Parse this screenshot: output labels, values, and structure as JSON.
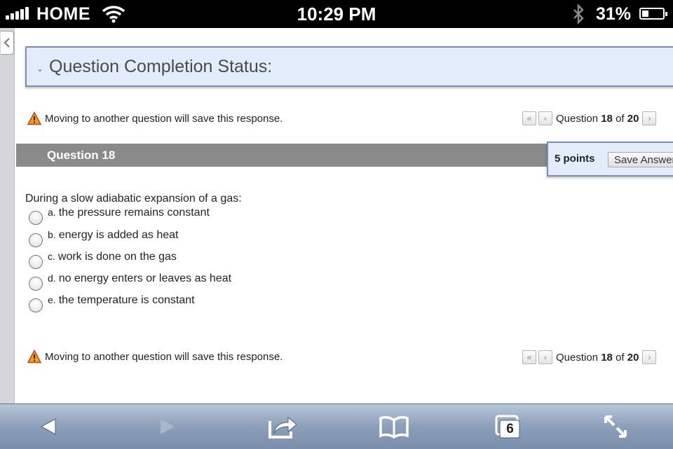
{
  "status_bar": {
    "carrier": "HOME",
    "time": "10:29 PM",
    "battery_percent": "31%",
    "battery_level": 0.31
  },
  "quiz": {
    "completion_status_title": "Question Completion Status:",
    "save_warning": "Moving to another question will save this response.",
    "nav": {
      "prefix": "Question",
      "current": "18",
      "of_label": "of",
      "total": "20"
    },
    "question_title": "Question 18",
    "points": "5 points",
    "save_button": "Save Answer",
    "question_text": "During a slow adiabatic expansion of a gas:",
    "options": [
      {
        "letter": "a.",
        "text": "the pressure remains constant"
      },
      {
        "letter": "b.",
        "text": "energy is added as heat"
      },
      {
        "letter": "c.",
        "text": "work is done on the gas"
      },
      {
        "letter": "d.",
        "text": "no energy enters or leaves as heat"
      },
      {
        "letter": "e.",
        "text": "the temperature is constant"
      }
    ]
  },
  "toolbar": {
    "tabs_count": "6",
    "icons": [
      "back-arrow-icon",
      "forward-arrow-icon",
      "share-icon",
      "bookmarks-icon",
      "tabs-icon",
      "fullscreen-icon"
    ]
  },
  "colors": {
    "panel_bg": "#e2ecfb",
    "panel_border": "#7b8fb4",
    "header_gray": "#8a8a8a",
    "warning_orange": "#f0a30a"
  }
}
